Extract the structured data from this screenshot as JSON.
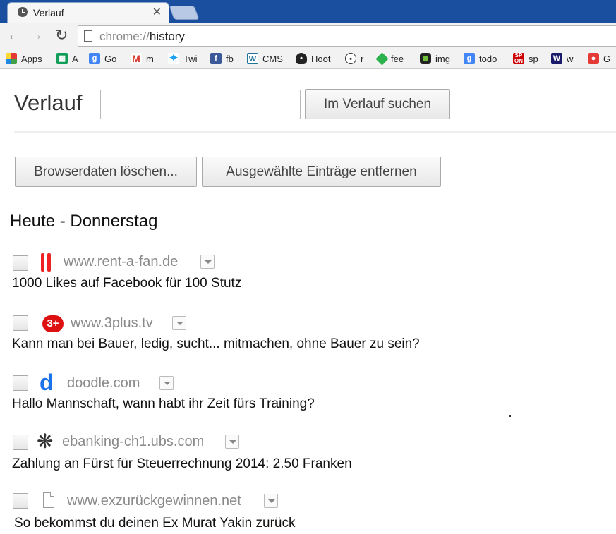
{
  "tab": {
    "title": "Verlauf",
    "close": "✕"
  },
  "toolbar": {
    "url_scheme": "chrome://",
    "url_path": "history"
  },
  "bookmarks": [
    {
      "label": "Apps",
      "icon": "apps-grid-icon"
    },
    {
      "label": "A",
      "icon": "sheets-icon"
    },
    {
      "label": "Go",
      "icon": "google-icon"
    },
    {
      "label": "m",
      "icon": "gmail-icon"
    },
    {
      "label": "Twi",
      "icon": "twitter-icon"
    },
    {
      "label": "fb",
      "icon": "facebook-icon"
    },
    {
      "label": "CMS",
      "icon": "wordpress-icon"
    },
    {
      "label": "Hoot",
      "icon": "hootsuite-icon"
    },
    {
      "label": "r",
      "icon": "reddit-icon"
    },
    {
      "label": "fee",
      "icon": "feedly-icon"
    },
    {
      "label": "img",
      "icon": "img-icon"
    },
    {
      "label": "todo",
      "icon": "google-icon"
    },
    {
      "label": "sp",
      "icon": "spiegel-online-icon"
    },
    {
      "label": "w",
      "icon": "word-icon"
    },
    {
      "label": "G",
      "icon": "google-red-icon"
    }
  ],
  "page": {
    "title": "Verlauf",
    "search_button": "Im Verlauf suchen",
    "clear_button": "Browserdaten löschen...",
    "remove_button": "Ausgewählte Einträge entfernen",
    "day_header": "Heute - Donnerstag"
  },
  "entries": [
    {
      "domain": "www.rent-a-fan.de",
      "title": "1000 Likes auf Facebook für 100 Stutz",
      "icon": "rent-a-fan-icon"
    },
    {
      "domain": "www.3plus.tv",
      "title": "Kann man bei Bauer, ledig, sucht... mitmachen, ohne Bauer zu sein?",
      "icon": "3plus-icon"
    },
    {
      "domain": "doodle.com",
      "title": "Hallo Mannschaft, wann habt ihr Zeit fürs Training?",
      "icon": "doodle-icon"
    },
    {
      "domain": "ebanking-ch1.ubs.com",
      "title": "Zahlung an Fürst für Steuerrechnung 2014: 2.50 Franken",
      "icon": "ubs-icon"
    },
    {
      "domain": "www.exzurückgewinnen.net",
      "title": "So bekommst du deinen Ex Murat Yakin zurück",
      "icon": "page-icon"
    }
  ],
  "colors": {
    "tabstrip": "#1a4fa0",
    "domain": "#8a8a8a"
  }
}
